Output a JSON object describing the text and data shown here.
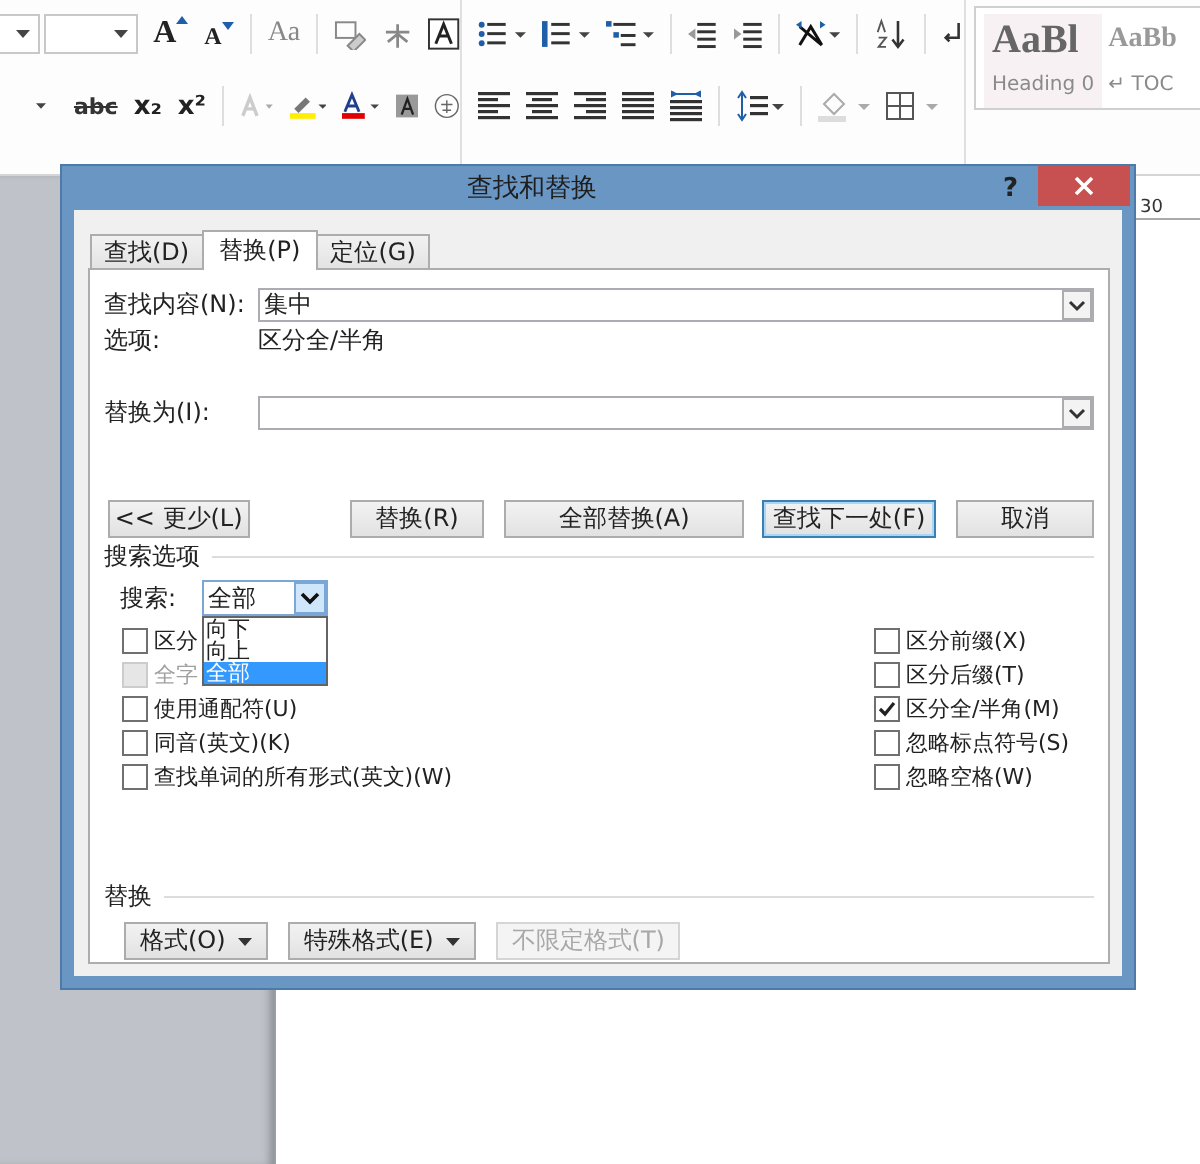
{
  "ribbon": {
    "glyphs": [
      "Aa",
      "abc",
      "x₂",
      "x²"
    ],
    "grow": "A",
    "shrink": "A",
    "styles": [
      {
        "sample": "AaBl",
        "name": "Heading 0"
      },
      {
        "sample": "AaBb",
        "name": "↵ TOC"
      }
    ]
  },
  "ruler": {
    "mark": "30"
  },
  "dialog": {
    "title": "查找和替换",
    "help": "?",
    "tabs": [
      {
        "label": "查找(D)",
        "selected": false
      },
      {
        "label": "替换(P)",
        "selected": true
      },
      {
        "label": "定位(G)",
        "selected": false
      }
    ],
    "find": {
      "label": "查找内容(N):",
      "value": "集中"
    },
    "options": {
      "label": "选项:",
      "value": "区分全/半角"
    },
    "replace": {
      "label": "替换为(I):"
    },
    "buttons": [
      {
        "label": "<< 更少(L)",
        "default": false
      },
      {
        "label": "替换(R)",
        "default": false
      },
      {
        "label": "全部替换(A)",
        "default": false
      },
      {
        "label": "查找下一处(F)",
        "default": true
      },
      {
        "label": "取消",
        "default": false
      }
    ],
    "search_options": {
      "heading": "搜索选项",
      "search_label": "搜索:",
      "search_value": "全部",
      "dropdown": [
        {
          "label": "向下",
          "selected": false
        },
        {
          "label": "向上",
          "selected": false
        },
        {
          "label": "全部",
          "selected": true
        }
      ],
      "left": [
        {
          "label": "区分",
          "checked": false,
          "disabled": false
        },
        {
          "label": "全字",
          "checked": false,
          "disabled": true
        },
        {
          "label": "使用通配符(U)",
          "checked": false,
          "disabled": false
        },
        {
          "label": "同音(英文)(K)",
          "checked": false,
          "disabled": false
        },
        {
          "label": "查找单词的所有形式(英文)(W)",
          "checked": false,
          "disabled": false
        }
      ],
      "right": [
        {
          "label": "区分前缀(X)",
          "checked": false,
          "disabled": false
        },
        {
          "label": "区分后缀(T)",
          "checked": false,
          "disabled": false
        },
        {
          "label": "区分全/半角(M)",
          "checked": true,
          "disabled": false
        },
        {
          "label": "忽略标点符号(S)",
          "checked": false,
          "disabled": false
        },
        {
          "label": "忽略空格(W)",
          "checked": false,
          "disabled": false
        }
      ]
    },
    "replace_section": {
      "heading": "替换",
      "buttons": [
        {
          "label": "格式(O)",
          "menu": true,
          "disabled": false
        },
        {
          "label": "特殊格式(E)",
          "menu": true,
          "disabled": false
        },
        {
          "label": "不限定格式(T)",
          "menu": false,
          "disabled": true
        }
      ]
    }
  }
}
